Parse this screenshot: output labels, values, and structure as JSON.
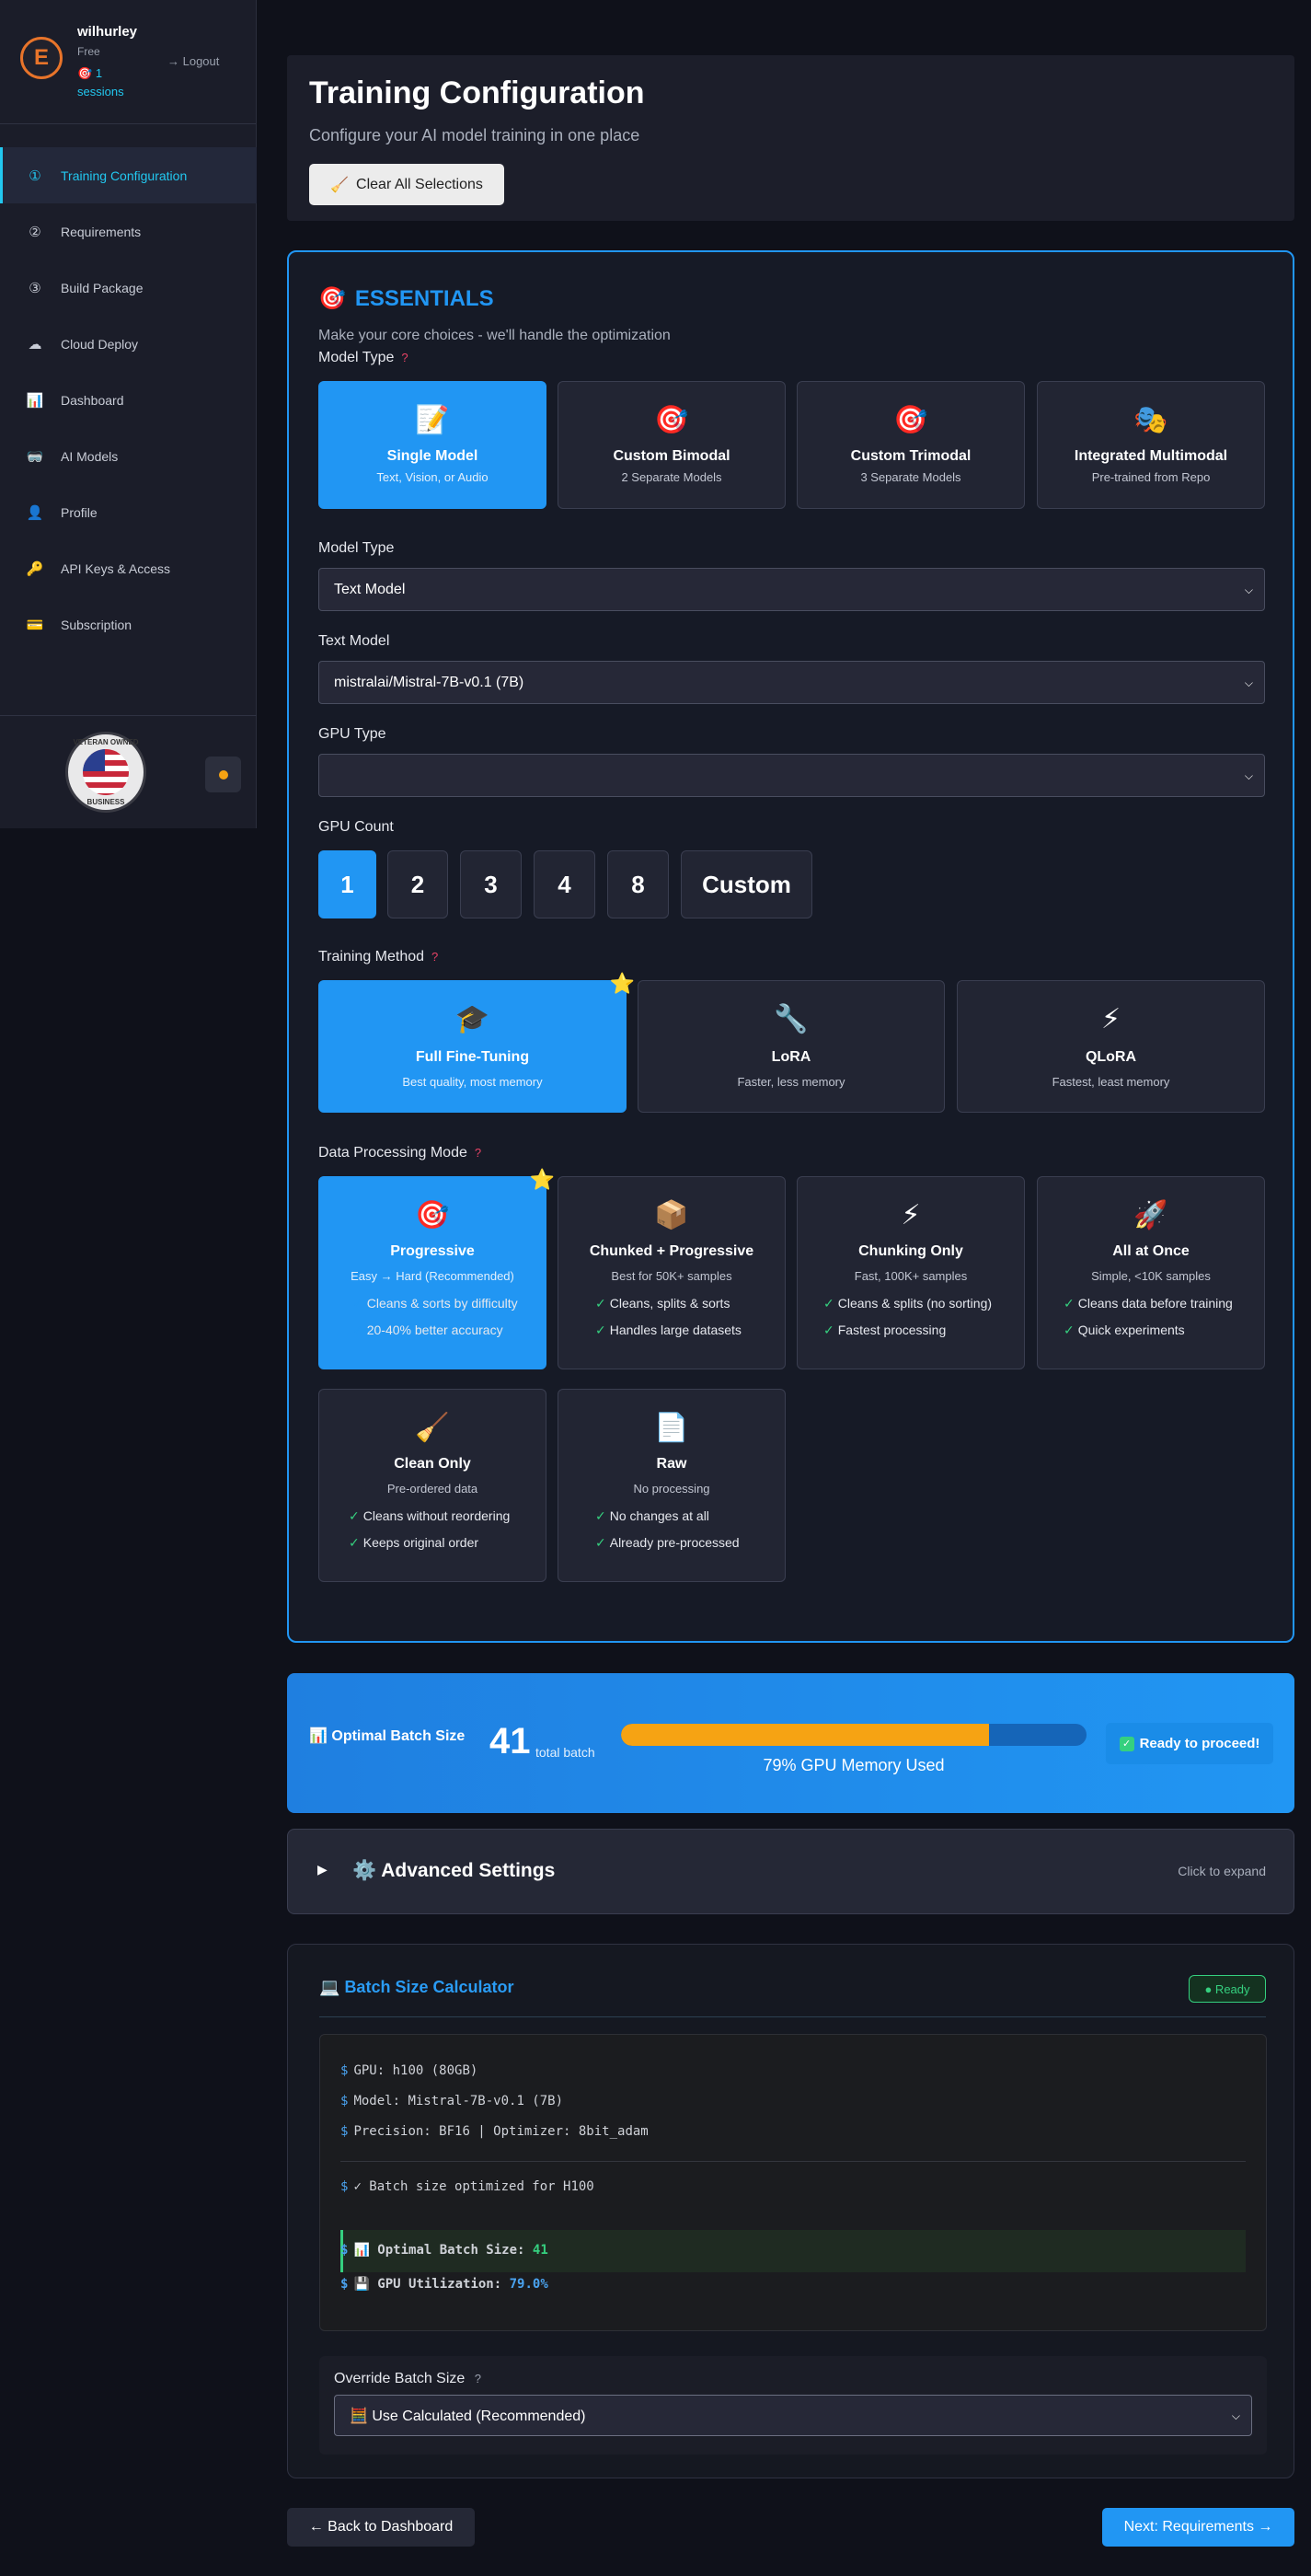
{
  "user": {
    "logo_letter": "E",
    "name": "wilhurley",
    "plan": "Free",
    "sessions_icon": "🎯",
    "sessions": "1 sessions",
    "logout": "→ Logout"
  },
  "nav": [
    {
      "icon": "①",
      "label": "Training Configuration",
      "active": true
    },
    {
      "icon": "②",
      "label": "Requirements"
    },
    {
      "icon": "③",
      "label": "Build Package"
    },
    {
      "icon": "☁",
      "label": "Cloud Deploy"
    },
    {
      "icon": "📊",
      "label": "Dashboard"
    },
    {
      "icon": "🥽",
      "label": "AI Models"
    },
    {
      "icon": "👤",
      "label": "Profile"
    },
    {
      "icon": "🔑",
      "label": "API Keys & Access"
    },
    {
      "icon": "💳",
      "label": "Subscription"
    }
  ],
  "badge": {
    "top": "VETERAN OWNED",
    "bottom": "BUSINESS"
  },
  "header": {
    "title": "Training Configuration",
    "subtitle": "Configure your AI model training in one place",
    "clear_icon": "🧹",
    "clear_label": "Clear All Selections"
  },
  "essentials": {
    "icon": "🎯",
    "title": "ESSENTIALS",
    "subtitle": "Make your core choices - we'll handle the optimization",
    "model_type_label": "Model Type",
    "help": "?",
    "model_cards": [
      {
        "icon": "📝",
        "title": "Single Model",
        "sub": "Text, Vision, or Audio",
        "selected": true
      },
      {
        "icon": "🎯",
        "title": "Custom Bimodal",
        "sub": "2 Separate Models"
      },
      {
        "icon": "🎯",
        "title": "Custom Trimodal",
        "sub": "3 Separate Models"
      },
      {
        "icon": "🎭",
        "title": "Integrated Multimodal",
        "sub": "Pre-trained from Repo"
      }
    ],
    "model_type_select_label": "Model Type",
    "model_type_value": "Text Model",
    "text_model_label": "Text Model",
    "text_model_value": "mistralai/Mistral-7B-v0.1 (7B)",
    "gpu_type_label": "GPU Type",
    "gpu_type_value": "",
    "gpu_count_label": "GPU Count",
    "gpu_counts": [
      "1",
      "2",
      "3",
      "4",
      "8",
      "Custom"
    ],
    "gpu_count_selected": "1",
    "training_method_label": "Training Method",
    "training_methods": [
      {
        "icon": "🎓",
        "title": "Full Fine-Tuning",
        "sub": "Best quality, most memory",
        "selected": true,
        "star": "⭐"
      },
      {
        "icon": "🔧",
        "title": "LoRA",
        "sub": "Faster, less memory"
      },
      {
        "icon": "⚡",
        "title": "QLoRA",
        "sub": "Fastest, least memory"
      }
    ],
    "data_mode_label": "Data Processing Mode",
    "data_modes": [
      {
        "icon": "🎯",
        "title": "Progressive",
        "sub": "Easy → Hard (Recommended)",
        "features": [
          "Cleans & sorts by difficulty",
          "20-40% better accuracy"
        ],
        "selected": true,
        "star": "⭐"
      },
      {
        "icon": "📦",
        "title": "Chunked + Progressive",
        "sub": "Best for 50K+ samples",
        "features": [
          "Cleans, splits & sorts",
          "Handles large datasets"
        ]
      },
      {
        "icon": "⚡",
        "title": "Chunking Only",
        "sub": "Fast, 100K+ samples",
        "features": [
          "Cleans & splits (no sorting)",
          "Fastest processing"
        ]
      },
      {
        "icon": "🚀",
        "title": "All at Once",
        "sub": "Simple, <10K samples",
        "features": [
          "Cleans data before training",
          "Quick experiments"
        ]
      },
      {
        "icon": "🧹",
        "title": "Clean Only",
        "sub": "Pre-ordered data",
        "features": [
          "Cleans without reordering",
          "Keeps original order"
        ]
      },
      {
        "icon": "📄",
        "title": "Raw",
        "sub": "No processing",
        "features": [
          "No changes at all",
          "Already pre-processed"
        ]
      }
    ],
    "check": "✓"
  },
  "banner": {
    "icon": "📊",
    "label": "Optimal Batch Size",
    "value": "41",
    "unit": "total batch",
    "memory_fraction": 0.79,
    "memory_text": "79% GPU Memory Used",
    "ready_icon": "✓",
    "ready": "Ready to proceed!"
  },
  "advanced": {
    "toggle": "▶",
    "icon": "⚙️",
    "title": "Advanced Settings",
    "hint": "Click to expand"
  },
  "calculator": {
    "icon": "💻",
    "title": "Batch Size Calculator",
    "status": "● Ready",
    "prompt": "$",
    "lines": [
      "GPU: h100 (80GB)",
      "Model: Mistral-7B-v0.1 (7B)",
      "Precision: BF16 | Optimizer: 8bit_adam",
      "✓ Batch size optimized for H100"
    ],
    "optimal_label": "📊 Optimal Batch Size:",
    "optimal_value": "41",
    "util_label": "💾 GPU Utilization:",
    "util_value": "79.0%",
    "override_label": "Override Batch Size",
    "override_help": "?",
    "override_value": "🧮 Use Calculated (Recommended)"
  },
  "footer": {
    "back": "← Back to Dashboard",
    "next": "Next: Requirements →"
  },
  "colors": {
    "accent": "#2196f3",
    "cyan": "#22c8f0",
    "success": "#35d07f",
    "warning": "#f6a313",
    "danger": "#e84366"
  }
}
